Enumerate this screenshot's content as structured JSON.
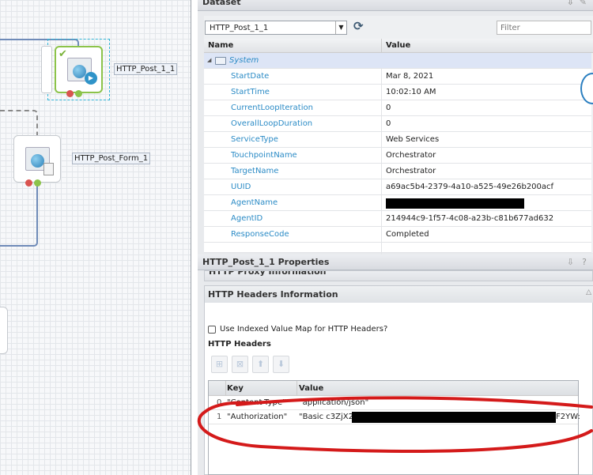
{
  "canvas": {
    "nodes": [
      {
        "label": "HTTP_Post_1_1",
        "selected": true
      },
      {
        "label": "HTTP_Post_Form_1",
        "selected": false
      }
    ]
  },
  "dataset": {
    "title": "Dataset",
    "selected_step": "HTTP_Post_1_1",
    "filter_placeholder": "Filter",
    "columns": [
      "Name",
      "Value"
    ],
    "group": "System",
    "rows": [
      {
        "name": "StartDate",
        "value": "Mar 8, 2021"
      },
      {
        "name": "StartTime",
        "value": "10:02:10 AM"
      },
      {
        "name": "CurrentLoopIteration",
        "value": "0"
      },
      {
        "name": "OverallLoopDuration",
        "value": "0"
      },
      {
        "name": "ServiceType",
        "value": "Web Services"
      },
      {
        "name": "TouchpointName",
        "value": "Orchestrator"
      },
      {
        "name": "TargetName",
        "value": "Orchestrator"
      },
      {
        "name": "UUID",
        "value": "a69ac5b4-2379-4a10-a525-49e26b200acf"
      },
      {
        "name": "AgentName",
        "value": ""
      },
      {
        "name": "AgentID",
        "value": "214944c9-1f57-4c08-a23b-c81b677ad632"
      },
      {
        "name": "ResponseCode",
        "value": "Completed"
      }
    ]
  },
  "properties": {
    "title": "HTTP_Post_1_1 Properties",
    "collapsed_section": "HTTP Proxy Information",
    "section_title": "HTTP Headers Information",
    "checkbox_label": "Use Indexed Value Map for HTTP Headers?",
    "checkbox_checked": false,
    "headers_label": "HTTP Headers",
    "headers_columns": [
      "Key",
      "Value"
    ],
    "headers": [
      {
        "index": "0",
        "key": "\"Content-Type\"",
        "value": "\"application/json\""
      },
      {
        "index": "1",
        "key": "\"Authorization\"",
        "value_prefix": "\"Basic c3ZjX2",
        "value_suffix": "F2YW:"
      }
    ]
  },
  "colors": {
    "annotation": "#d41a1a",
    "link": "#2b8bc6",
    "selected_node": "#8cc34a"
  }
}
